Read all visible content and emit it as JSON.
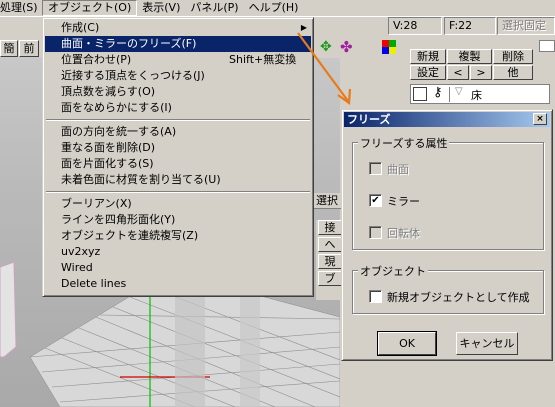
{
  "menubar": {
    "items": [
      "処理(S)",
      "オブジェクト(O)",
      "表示(V)",
      "パネル(P)",
      "ヘルプ(H)"
    ]
  },
  "toolbar": {
    "btn1": "簡",
    "btn2": "前"
  },
  "status": {
    "vertex": "V:28",
    "face": "F:22",
    "select_fixed": "選択固定"
  },
  "dropdown": {
    "group1": [
      {
        "label": "作成(C)",
        "shortcut": "",
        "submenu": true
      },
      {
        "label": "曲面・ミラーのフリーズ(F)",
        "shortcut": "",
        "highlight": true
      },
      {
        "label": "位置合わせ(P)",
        "shortcut": "Shift+無変換"
      },
      {
        "label": "近接する頂点をくっつける(J)",
        "shortcut": ""
      },
      {
        "label": "頂点数を減らす(O)",
        "shortcut": ""
      },
      {
        "label": "面をなめらかにする(I)",
        "shortcut": ""
      }
    ],
    "group2": [
      {
        "label": "面の方向を統一する(A)"
      },
      {
        "label": "重なる面を削除(D)"
      },
      {
        "label": "面を片面化する(S)"
      },
      {
        "label": "未着色面に材質を割り当てる(U)"
      }
    ],
    "group3": [
      {
        "label": "ブーリアン(X)"
      },
      {
        "label": "ラインを四角形面化(Y)"
      },
      {
        "label": "オブジェクトを連続複写(Z)"
      },
      {
        "label": "uv2xyz"
      },
      {
        "label": "Wired"
      },
      {
        "label": "Delete lines"
      }
    ]
  },
  "panel": {
    "new": "新規",
    "duplicate": "複製",
    "delete": "削除",
    "settings": "設定",
    "prev": "<",
    "next": ">",
    "other": "他",
    "object_name": "床",
    "select_tab": "選択",
    "side_labels": [
      "接",
      "へ",
      "現",
      "ブ"
    ]
  },
  "dialog": {
    "title": "フリーズ",
    "close": "×",
    "group_attr": "フリーズする属性",
    "curve": {
      "label": "曲面",
      "checked": false,
      "enabled": false,
      "mark": ""
    },
    "mirror": {
      "label": "ミラー",
      "checked": true,
      "enabled": true,
      "mark": "✔"
    },
    "rotate": {
      "label": "回転体",
      "checked": false,
      "enabled": false,
      "mark": ""
    },
    "group_obj": "オブジェクト",
    "new_object": {
      "label": "新規オブジェクトとして作成",
      "checked": false,
      "mark": ""
    },
    "ok": "OK",
    "cancel": "キャンセル"
  },
  "colors": {
    "highlight": "#0a246a",
    "annotation_arrow": "#e87a1a"
  }
}
